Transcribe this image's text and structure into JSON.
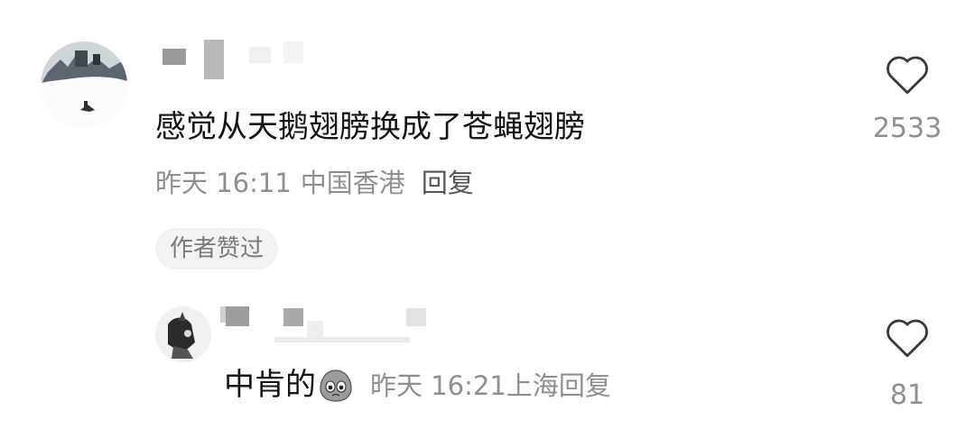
{
  "comments": [
    {
      "text": "感觉从天鹅翅膀换成了苍蝇翅膀",
      "time": "昨天 16:11",
      "location": "中国香港",
      "reply_label": "回复",
      "author_badge": "作者赞过",
      "likes": "2533",
      "like_icon": "heart-outline-icon"
    },
    {
      "text": "中肯的",
      "emoji": "sob-face-emoji",
      "time": "昨天 16:21",
      "location": "上海",
      "reply_label": "回复",
      "likes": "81",
      "like_icon": "heart-outline-icon"
    }
  ]
}
